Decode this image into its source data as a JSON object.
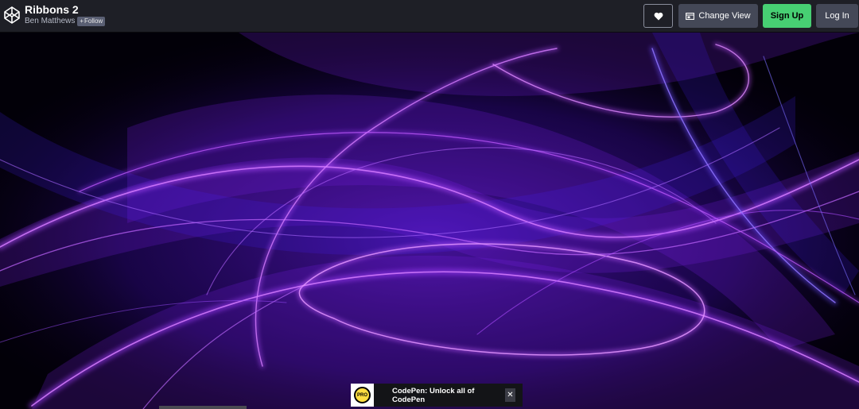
{
  "header": {
    "logo_icon": "codepen-logo-icon",
    "title": "Ribbons 2",
    "author": "Ben Matthews",
    "follow_label": "Follow",
    "follow_icon": "plus-icon"
  },
  "toolbar": {
    "heart_icon": "heart-icon",
    "change_view_label": "Change View",
    "change_view_icon": "layout-icon",
    "signup_label": "Sign Up",
    "login_label": "Log In"
  },
  "promo": {
    "badge": "PRO",
    "text": "CodePen: Unlock all of CodePen",
    "close_label": "✕"
  },
  "colors": {
    "topbar_bg": "#1e1f26",
    "button_bg": "#444857",
    "signup_bg": "#47cf73",
    "ribbon_primary": "#9b30ff",
    "ribbon_secondary": "#5a2bff"
  }
}
